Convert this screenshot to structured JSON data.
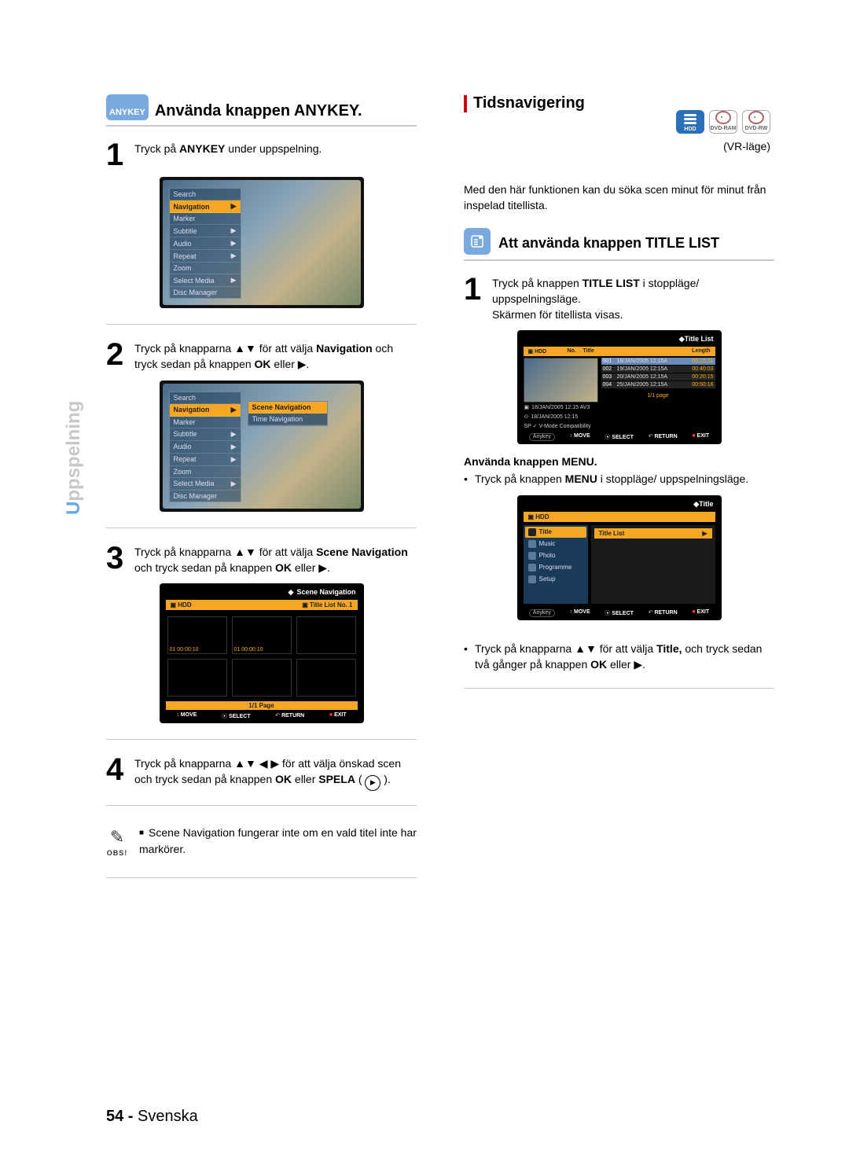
{
  "sidebar": {
    "full": "Uppspelning",
    "hi": "U",
    "rest": "ppspelning"
  },
  "left": {
    "anykey_badge": "ANYKEY",
    "heading": "Använda knappen ANYKEY.",
    "step1": {
      "pre": "Tryck på ",
      "bold": "ANYKEY",
      "post": " under uppspelning."
    },
    "step2": {
      "pre": "Tryck på knapparna ▲▼ för att välja ",
      "bold1": "Navigation",
      "mid": " och tryck sedan på knappen ",
      "bold2": "OK",
      "post": " eller ▶."
    },
    "step3": {
      "pre": "Tryck på knapparna ▲▼ för att välja ",
      "bold1": "Scene Navigation",
      "mid": " och tryck sedan på knappen ",
      "bold2": "OK",
      "post": " eller ▶."
    },
    "step4": {
      "pre": "Tryck på knapparna ▲▼ ◀ ▶ för att välja önskad scen och tryck sedan på knappen ",
      "bold1": "OK",
      "mid": " eller ",
      "bold2": "SPELA",
      "post": " ( "
    },
    "note": {
      "label": "OBS!",
      "text": "Scene Navigation fungerar inte om en vald titel inte har markörer."
    },
    "osd_menu": {
      "items": [
        "Search",
        "Navigation",
        "Marker",
        "Subtitle",
        "Audio",
        "Repeat",
        "Zoom",
        "Select Media",
        "Disc Manager"
      ],
      "sub": [
        "Scene Navigation",
        "Time Navigation"
      ]
    },
    "osd_scene": {
      "title": "Scene Navigation",
      "bar_left": "HDD",
      "bar_right": "Title List  No. 1",
      "thumbs": [
        "01  00:00:10",
        "01  00:00:10",
        "",
        "",
        "",
        ""
      ],
      "page": "1/1 Page",
      "foot": [
        "MOVE",
        "SELECT",
        "RETURN",
        "EXIT"
      ]
    }
  },
  "right": {
    "section": "Tidsnavigering",
    "vr": "(VR-läge)",
    "media": {
      "hdd": "HDD",
      "ram": "DVD-RAM",
      "rw": "DVD-RW"
    },
    "intro": "Med den här funktionen kan du söka scen minut för minut från inspelad titellista.",
    "sub_heading": "Att använda knappen TITLE LIST",
    "step1": {
      "pre": "Tryck på knappen ",
      "bold": "TITLE LIST",
      "mid": " i stoppläge/ uppspelningsläge.",
      "post": "Skärmen för titellista visas."
    },
    "menu_heading": "Använda knappen MENU.",
    "menu_bullet": {
      "pre": "Tryck på knappen ",
      "bold": "MENU",
      "post": " i stoppläge/ uppspelningsläge."
    },
    "title_bullet": {
      "pre": "Tryck på knapparna ▲▼ för att välja ",
      "bold1": "Title,",
      "mid": " och tryck sedan två gånger på knappen ",
      "bold2": "OK",
      "post": " eller ▶."
    },
    "osd_titlelist": {
      "title": "Title List",
      "bar": [
        "HDD",
        "No.",
        "Title",
        "Length"
      ],
      "rows": [
        {
          "no": "001",
          "t": "18/JAN/2005 12:15A",
          "len": "00:10:21"
        },
        {
          "no": "002",
          "t": "19/JAN/2005 12:15A",
          "len": "00:40:03"
        },
        {
          "no": "003",
          "t": "20/JAN/2005 12:15A",
          "len": "00:20:15"
        },
        {
          "no": "004",
          "t": "25/JAN/2005 12:15A",
          "len": "00:50:16"
        }
      ],
      "meta1": "18/JAN/2005 12:15 AV3",
      "meta2": "18/JAN/2005 12:15",
      "meta3": "SP ✓ V-Mode Compatibility",
      "page": "1/1  page",
      "anykey": "Anykey",
      "foot": [
        "MOVE",
        "SELECT",
        "RETURN",
        "EXIT"
      ]
    },
    "osd_title": {
      "title": "Title",
      "bar_left": "HDD",
      "side": [
        "Title",
        "Music",
        "Photo",
        "Programme",
        "Setup"
      ],
      "right_row": "Title List",
      "anykey": "Anykey",
      "foot": [
        "MOVE",
        "SELECT",
        "RETURN",
        "EXIT"
      ]
    }
  },
  "footer": {
    "page": "54 -",
    "lang": "Svenska"
  }
}
